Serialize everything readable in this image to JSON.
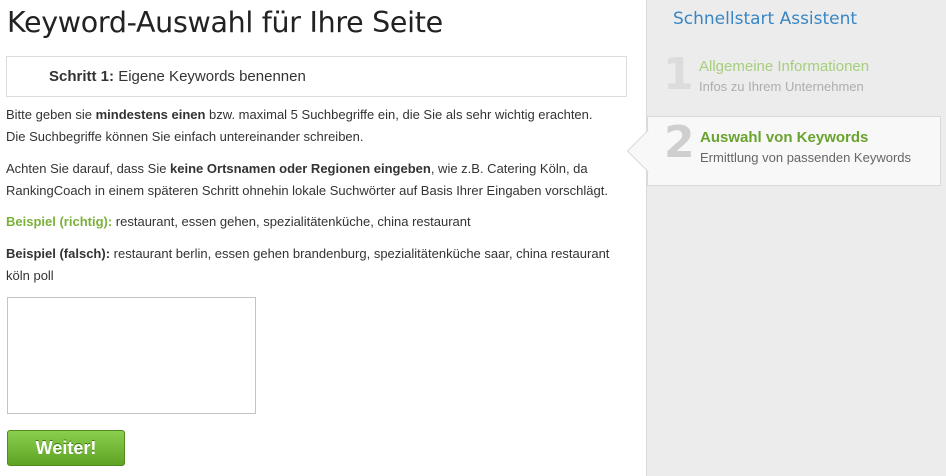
{
  "page": {
    "title": "Keyword-Auswahl für Ihre Seite"
  },
  "step_box": {
    "prefix": "Schritt 1:",
    "title": "Eigene Keywords benennen"
  },
  "instructions": {
    "p1_a": "Bitte geben sie ",
    "p1_bold": "mindestens einen",
    "p1_b": " bzw. maximal 5 Suchbegriffe ein, die Sie als sehr wichtig erachten.",
    "p1_line2": "Die Suchbegriffe können Sie einfach untereinander schreiben.",
    "p2_a": "Achten Sie darauf, dass Sie ",
    "p2_bold": "keine Ortsnamen oder Regionen eingeben",
    "p2_b": ", wie z.B. Catering Köln, da",
    "p2_line2": "RankingCoach in einem späteren Schritt ohnehin lokale Suchwörter auf Basis Ihrer Eingaben vorschlägt.",
    "example_correct_label": "Beispiel (richtig):",
    "example_correct_text": " restaurant, essen gehen, spezialitätenküche, china restaurant",
    "example_wrong_label": "Beispiel (falsch):",
    "example_wrong_text": " restaurant berlin, essen gehen brandenburg, spezialitätenküche saar, china restaurant",
    "example_wrong_line2": "köln poll"
  },
  "keywords_input": {
    "value": ""
  },
  "next_button": {
    "label": "Weiter!"
  },
  "sidebar": {
    "title": "Schnellstart Assistent",
    "steps": [
      {
        "number": "1",
        "label": "Allgemeine Informationen",
        "sub": "Infos zu Ihrem Unternehmen",
        "state": "inactive"
      },
      {
        "number": "2",
        "label": "Auswahl von Keywords",
        "sub": "Ermittlung von passenden Keywords",
        "state": "active"
      }
    ]
  },
  "colors": {
    "accent_blue": "#3a86c4",
    "accent_green": "#7bb13a",
    "button_green": "#5fa324"
  }
}
